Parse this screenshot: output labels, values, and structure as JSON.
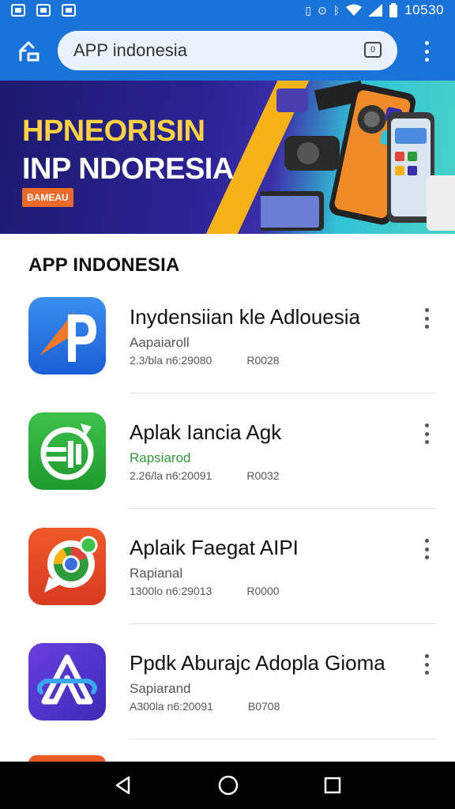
{
  "status_bar": {
    "time": "10530",
    "left_icons": [
      "notification-icon",
      "image-icon",
      "shield-icon"
    ],
    "right_icons": [
      "vibrate-icon",
      "sync-icon",
      "bluetooth-icon",
      "wifi-icon",
      "signal-icon",
      "battery-icon"
    ]
  },
  "app_bar": {
    "search_value": "APP indonesia",
    "tab_count": "0",
    "accent": "#1a73d8"
  },
  "banner": {
    "title_line1": "HPNEORISIN",
    "title_line2": "INP NDORESIA",
    "badge": "BAMEAU"
  },
  "section": {
    "title": "APP INDONESIA"
  },
  "apps": [
    {
      "name": "Inydensiian kle Adlouesia",
      "developer": "Aapaiaroll",
      "meta1": "2.3/bla n6:29080",
      "meta2": "R0028",
      "icon": "arrow-p-icon"
    },
    {
      "name": "Aplak Iancia Agk",
      "developer": "Rapsiarod",
      "meta1": "2.26/la n6:20091",
      "meta2": "R0032",
      "icon": "recycle-money-icon"
    },
    {
      "name": "Aplaik Faegat AIPI",
      "developer": "Rapianal",
      "meta1": "1300lo n6:29013",
      "meta2": "R0000",
      "icon": "chat-browser-icon"
    },
    {
      "name": "Ppdk Aburajc Adopla Gioma",
      "developer": "Sapiarand",
      "meta1": "A300la n6:20091",
      "meta2": "B0708",
      "icon": "app-store-a-icon"
    }
  ]
}
